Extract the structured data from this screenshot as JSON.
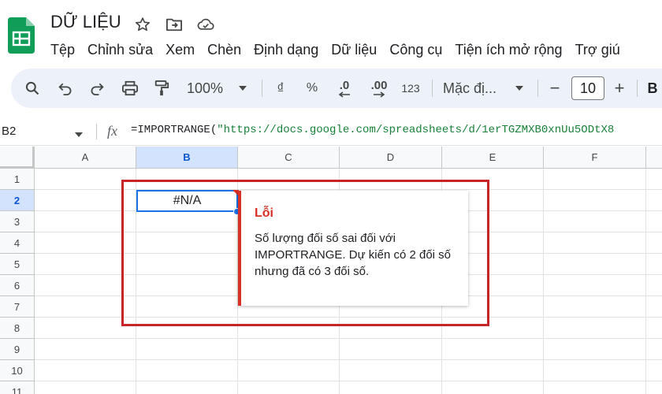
{
  "app": {
    "doc_title": "DỮ LIỆU",
    "brand_color": "#0f9d58"
  },
  "menu": [
    "Tệp",
    "Chỉnh sửa",
    "Xem",
    "Chèn",
    "Định dạng",
    "Dữ liệu",
    "Công cụ",
    "Tiện ích mở rộng",
    "Trợ giú"
  ],
  "toolbar": {
    "zoom": "100%",
    "currency": "₫",
    "percent": "%",
    "decrease_decimal": ".0",
    "increase_decimal": ".00",
    "more_formats": "123",
    "font_name": "Mặc đị...",
    "font_size": "10",
    "minus": "−",
    "plus": "+",
    "bold": "B"
  },
  "formula_bar": {
    "cell_ref": "B2",
    "fx": "fx",
    "formula_prefix": "=IMPORTRANGE(",
    "formula_string": "\"https://docs.google.com/spreadsheets/d/1erTGZMXB0xnUu5ODtX8"
  },
  "grid": {
    "columns": [
      "A",
      "B",
      "C",
      "D",
      "E",
      "F"
    ],
    "selected_column": "B",
    "rows": [
      "1",
      "2",
      "3",
      "4",
      "5",
      "6",
      "7",
      "8",
      "9",
      "10",
      "11"
    ],
    "selected_row": "2",
    "active_cell_value": "#N/A"
  },
  "error_popup": {
    "title": "Lỗi",
    "message": "Số lượng đối số sai đối với IMPORTRANGE. Dự kiến có 2 đối số nhưng đã có 3 đối số.",
    "accent_color": "#d93025"
  },
  "annotation": {
    "color": "#c8252b"
  }
}
